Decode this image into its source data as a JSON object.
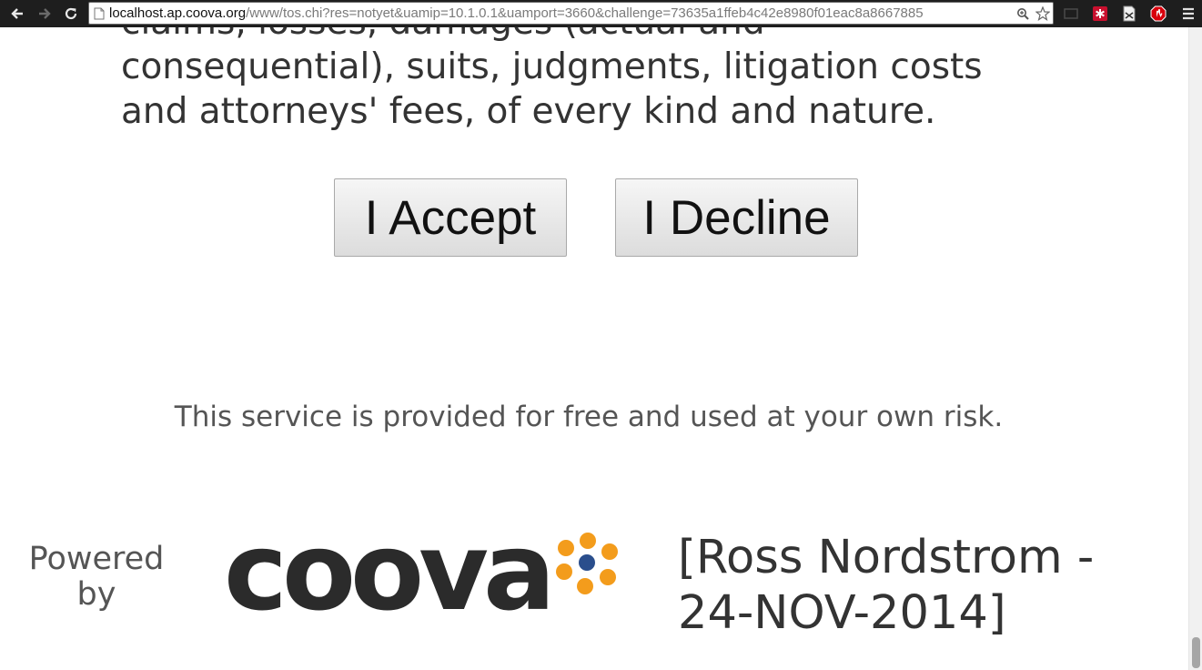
{
  "browser": {
    "url_host": "localhost.ap.coova.org",
    "url_path": "/www/tos.chi?res=notyet&uamip=10.1.0.1&uamport=3660&challenge=73635a1ffeb4c42e8980f01eac8a8667885"
  },
  "page": {
    "tos_text": "claims, losses, damages (actual and\nconsequential), suits, judgments, litigation costs\nand attorneys' fees, of every kind and nature.",
    "accept_label": "I Accept",
    "decline_label": "I Decline",
    "disclaimer": "This service is provided for free and used at your own risk.",
    "powered_by": "Powered\nby",
    "logo_text": "coova",
    "credit": "[Ross Nordstrom -\n24-NOV-2014]"
  },
  "colors": {
    "logo_petal": "#f39c1c",
    "logo_center": "#2a4e8c"
  }
}
